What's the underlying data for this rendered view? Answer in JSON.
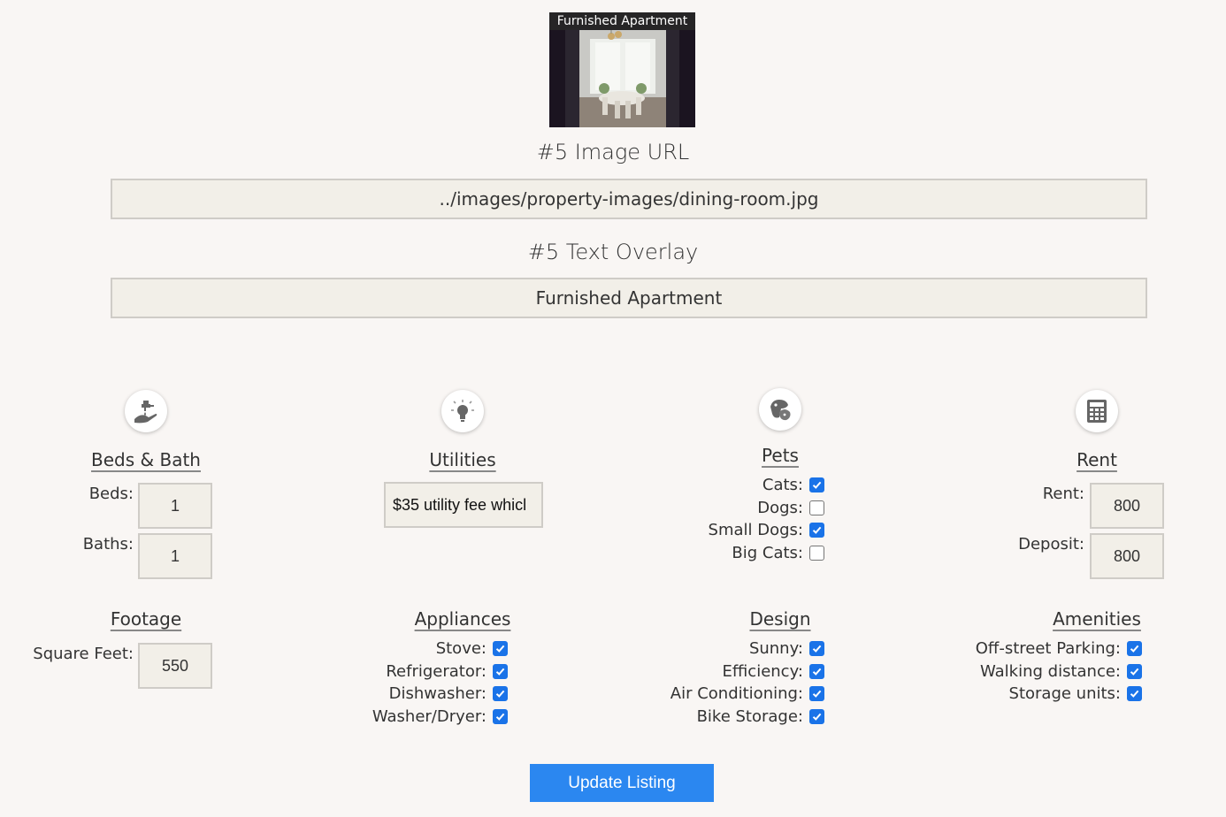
{
  "preview": {
    "overlay_text": "Furnished Apartment"
  },
  "image_url": {
    "label": "#5 Image URL",
    "value": "../images/property-images/dining-room.jpg"
  },
  "text_overlay": {
    "label": "#5 Text Overlay",
    "value": "Furnished Apartment"
  },
  "beds_bath": {
    "title": "Beds & Bath",
    "icon": "faucet-icon",
    "beds_label": "Beds:",
    "beds_value": "1",
    "baths_label": "Baths:",
    "baths_value": "1"
  },
  "utilities": {
    "title": "Utilities",
    "icon": "lightbulb-icon",
    "value": "$35 utility fee whicl"
  },
  "pets": {
    "title": "Pets",
    "icon": "paw-icon",
    "items": [
      {
        "label": "Cats:",
        "checked": true
      },
      {
        "label": "Dogs:",
        "checked": false
      },
      {
        "label": "Small Dogs:",
        "checked": true
      },
      {
        "label": "Big Cats:",
        "checked": false
      }
    ]
  },
  "rent": {
    "title": "Rent",
    "icon": "calculator-icon",
    "rent_label": "Rent:",
    "rent_value": "800",
    "deposit_label": "Deposit:",
    "deposit_value": "800"
  },
  "footage": {
    "title": "Footage",
    "sqft_label": "Square Feet:",
    "sqft_value": "550"
  },
  "appliances": {
    "title": "Appliances",
    "items": [
      {
        "label": "Stove:",
        "checked": true
      },
      {
        "label": "Refrigerator:",
        "checked": true
      },
      {
        "label": "Dishwasher:",
        "checked": true
      },
      {
        "label": "Washer/Dryer:",
        "checked": true
      }
    ]
  },
  "design": {
    "title": "Design",
    "items": [
      {
        "label": "Sunny:",
        "checked": true
      },
      {
        "label": "Efficiency:",
        "checked": true
      },
      {
        "label": "Air Conditioning:",
        "checked": true
      },
      {
        "label": "Bike Storage:",
        "checked": true
      }
    ]
  },
  "amenities": {
    "title": "Amenities",
    "items": [
      {
        "label": "Off-street Parking:",
        "checked": true
      },
      {
        "label": "Walking distance:",
        "checked": true
      },
      {
        "label": "Storage units:",
        "checked": true
      }
    ]
  },
  "submit_label": "Update Listing",
  "colors": {
    "accent": "#2b87f0",
    "checkbox": "#1a73e8",
    "field_bg": "#f2efe8",
    "page_bg": "#f9f6f4"
  }
}
